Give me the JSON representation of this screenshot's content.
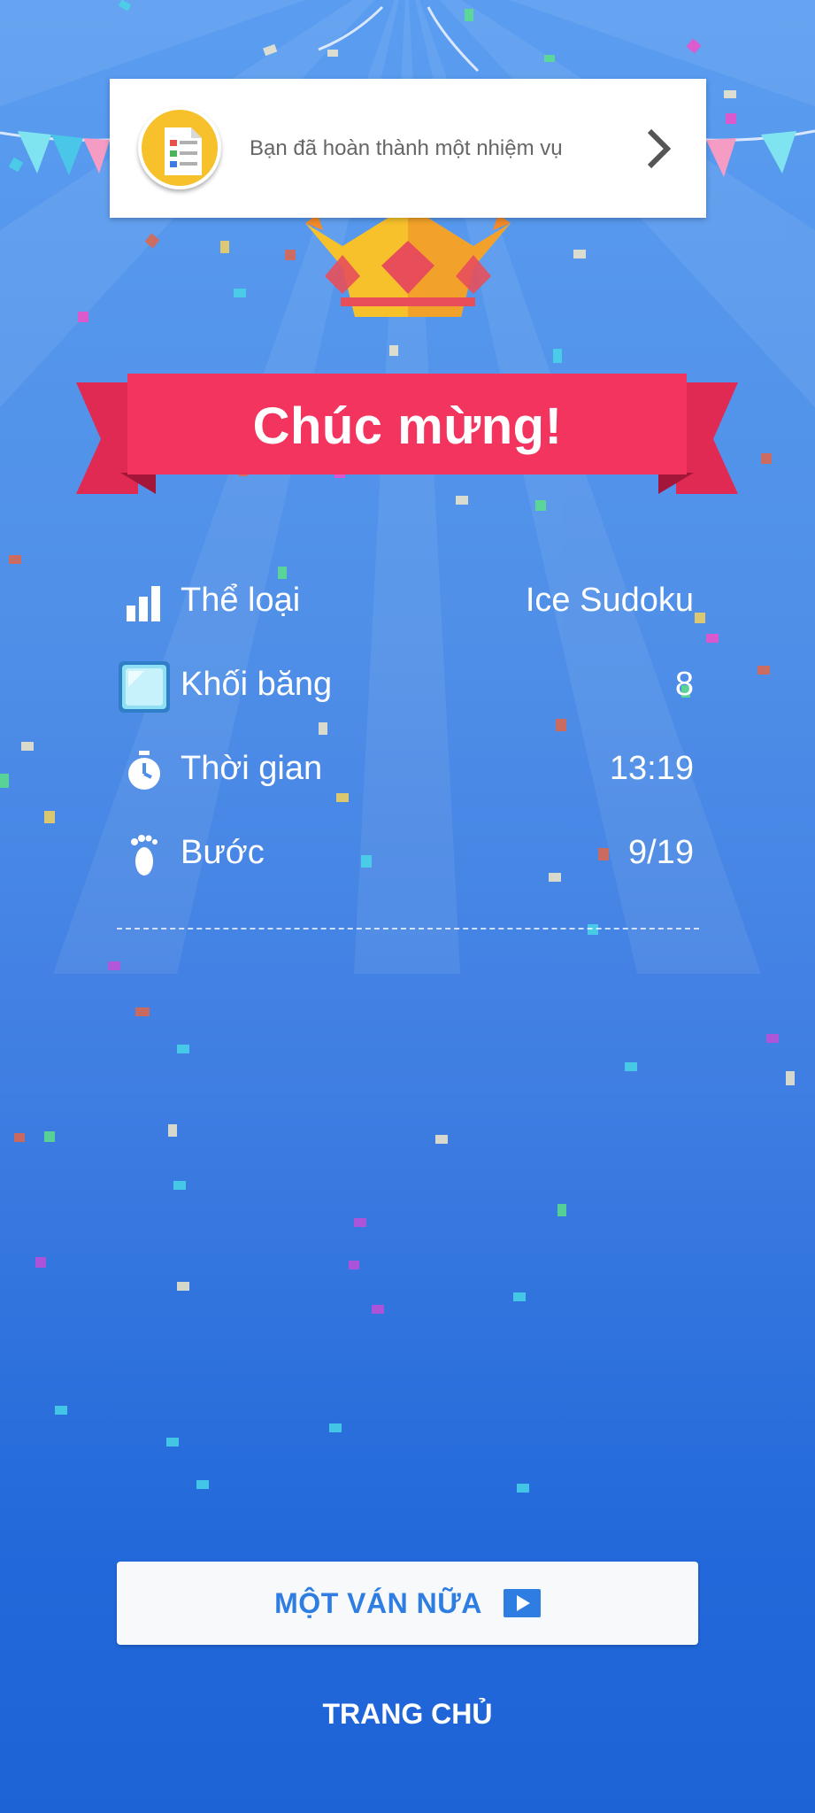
{
  "notification": {
    "text": "Bạn đã hoàn thành một nhiệm vụ",
    "icon": "task-document-icon",
    "arrow_icon": "chevron-right-icon"
  },
  "banner": {
    "title": "Chúc mừng!",
    "crown_icon": "crown-icon"
  },
  "stats": [
    {
      "icon": "bar-chart-icon",
      "label": "Thể loại",
      "value": "Ice Sudoku"
    },
    {
      "icon": "ice-block-icon",
      "label": "Khối băng",
      "value": "8"
    },
    {
      "icon": "stopwatch-icon",
      "label": "Thời gian",
      "value": "13:19"
    },
    {
      "icon": "footprint-icon",
      "label": "Bước",
      "value": "9/19"
    }
  ],
  "buttons": {
    "play_again": "MỘT VÁN NỮA",
    "play_icon": "play-icon",
    "home": "TRANG CHỦ"
  },
  "colors": {
    "background_top": "#5a9df0",
    "background_bottom": "#1e63d6",
    "ribbon": "#f2345f",
    "ribbon_dark": "#c51e46",
    "accent": "#2d7de2",
    "crown": "#f6c12a"
  }
}
